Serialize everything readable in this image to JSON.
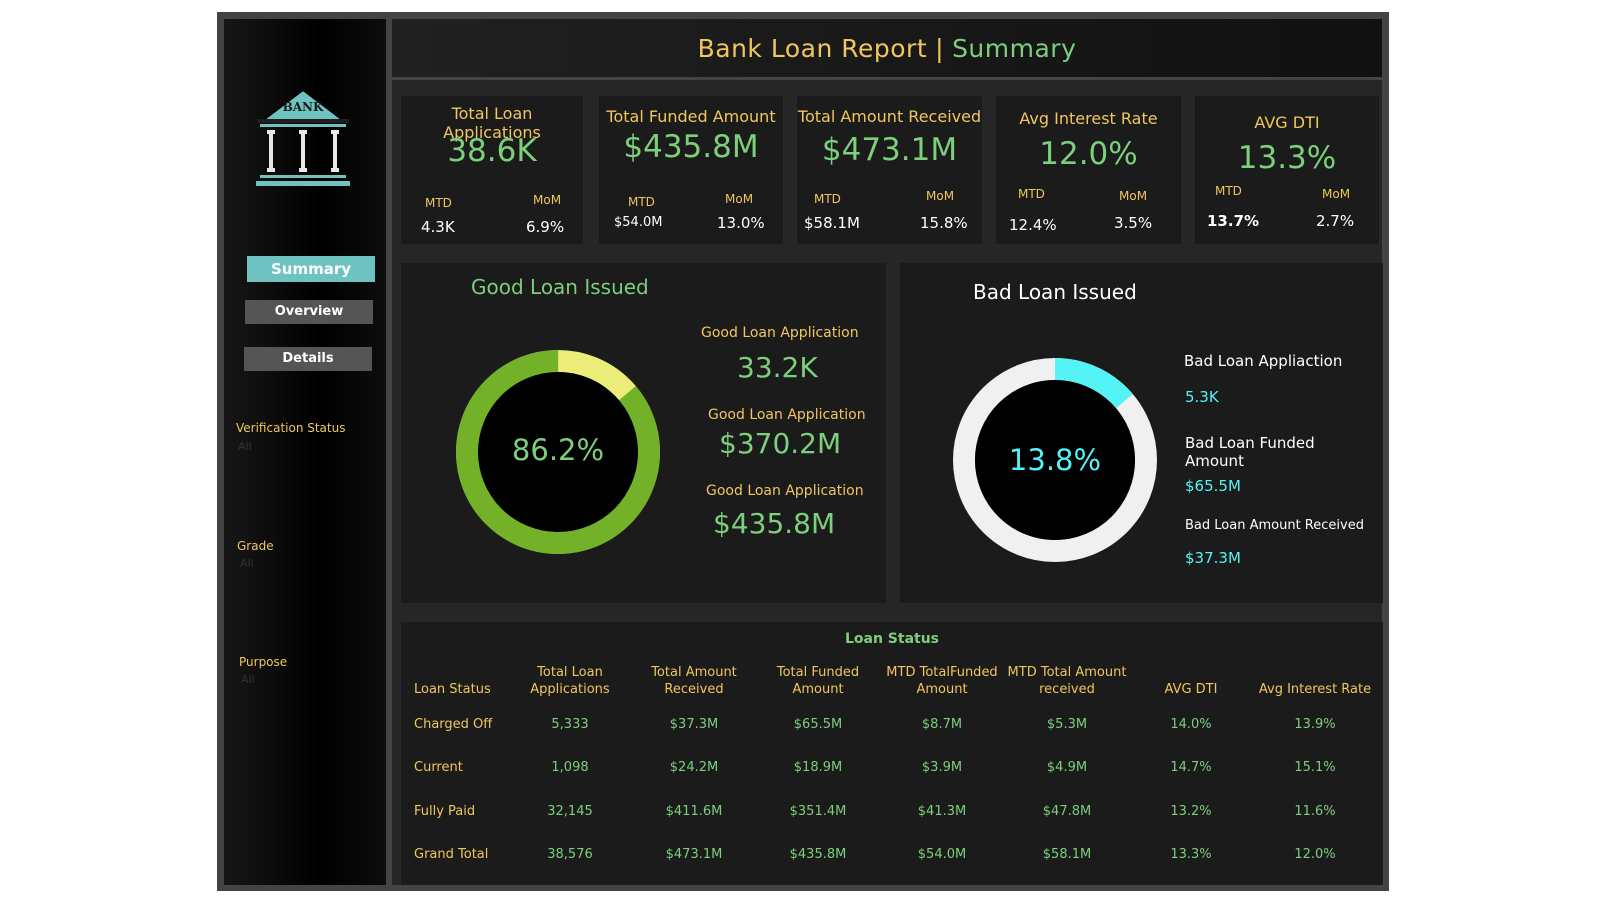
{
  "header": {
    "title": "Bank Loan Report",
    "separator": "|",
    "subtitle": "Summary"
  },
  "logo": {
    "text": "BANK"
  },
  "nav": {
    "summary": "Summary",
    "overview": "Overview",
    "details": "Details"
  },
  "filters": [
    {
      "label": "Verification Status",
      "value": "All"
    },
    {
      "label": "Grade",
      "value": "All"
    },
    {
      "label": "Purpose",
      "value": "All"
    }
  ],
  "kpis": [
    {
      "label": "Total Loan Applications",
      "value": "38.6K",
      "mtd_label": "MTD",
      "mtd": "4.3K",
      "mom_label": "MoM",
      "mom": "6.9%"
    },
    {
      "label": "Total Funded Amount",
      "value": "$435.8M",
      "mtd_label": "MTD",
      "mtd": "$54.0M",
      "mom_label": "MoM",
      "mom": "13.0%"
    },
    {
      "label": "Total Amount Received",
      "value": "$473.1M",
      "mtd_label": "MTD",
      "mtd": "$58.1M",
      "mom_label": "MoM",
      "mom": "15.8%"
    },
    {
      "label": "Avg Interest Rate",
      "value": "12.0%",
      "mtd_label": "MTD",
      "mtd": "12.4%",
      "mom_label": "MoM",
      "mom": "3.5%"
    },
    {
      "label": "AVG DTI",
      "value": "13.3%",
      "mtd_label": "MTD",
      "mtd": "13.7%",
      "mom_label": "MoM",
      "mom": "2.7%"
    }
  ],
  "good_loan": {
    "title": "Good Loan Issued",
    "percent": "86.2%",
    "percent_value": 86.2,
    "colors": {
      "main": "#72b128",
      "rest": "#ecec78"
    },
    "metrics": [
      {
        "label": "Good Loan Application",
        "value": "33.2K"
      },
      {
        "label": "Good Loan Application",
        "value": "$370.2M"
      },
      {
        "label": "Good Loan Application",
        "value": "$435.8M"
      }
    ]
  },
  "bad_loan": {
    "title": "Bad Loan Issued",
    "percent": "13.8%",
    "percent_value": 13.8,
    "colors": {
      "main": "#54f3f5",
      "rest": "#f0f0f0"
    },
    "metrics": [
      {
        "label": "Bad Loan Appliaction",
        "value": "5.3K"
      },
      {
        "label": "Bad Loan Funded Amount",
        "value": "$65.5M"
      },
      {
        "label": "Bad Loan Amount Received",
        "value": "$37.3M"
      }
    ]
  },
  "loan_status": {
    "title": "Loan Status",
    "headers": [
      "Loan Status",
      "Total Loan Applications",
      "Total Amount Received",
      "Total Funded Amount",
      "MTD TotalFunded Amount",
      "MTD Total Amount received",
      "AVG DTI",
      "Avg Interest Rate"
    ],
    "rows": [
      [
        "Charged Off",
        "5,333",
        "$37.3M",
        "$65.5M",
        "$8.7M",
        "$5.3M",
        "14.0%",
        "13.9%"
      ],
      [
        "Current",
        "1,098",
        "$24.2M",
        "$18.9M",
        "$3.9M",
        "$4.9M",
        "14.7%",
        "15.1%"
      ],
      [
        "Fully Paid",
        "32,145",
        "$411.6M",
        "$351.4M",
        "$41.3M",
        "$47.8M",
        "13.2%",
        "11.6%"
      ],
      [
        "Grand Total",
        "38,576",
        "$473.1M",
        "$435.8M",
        "$54.0M",
        "$58.1M",
        "13.3%",
        "12.0%"
      ]
    ]
  }
}
